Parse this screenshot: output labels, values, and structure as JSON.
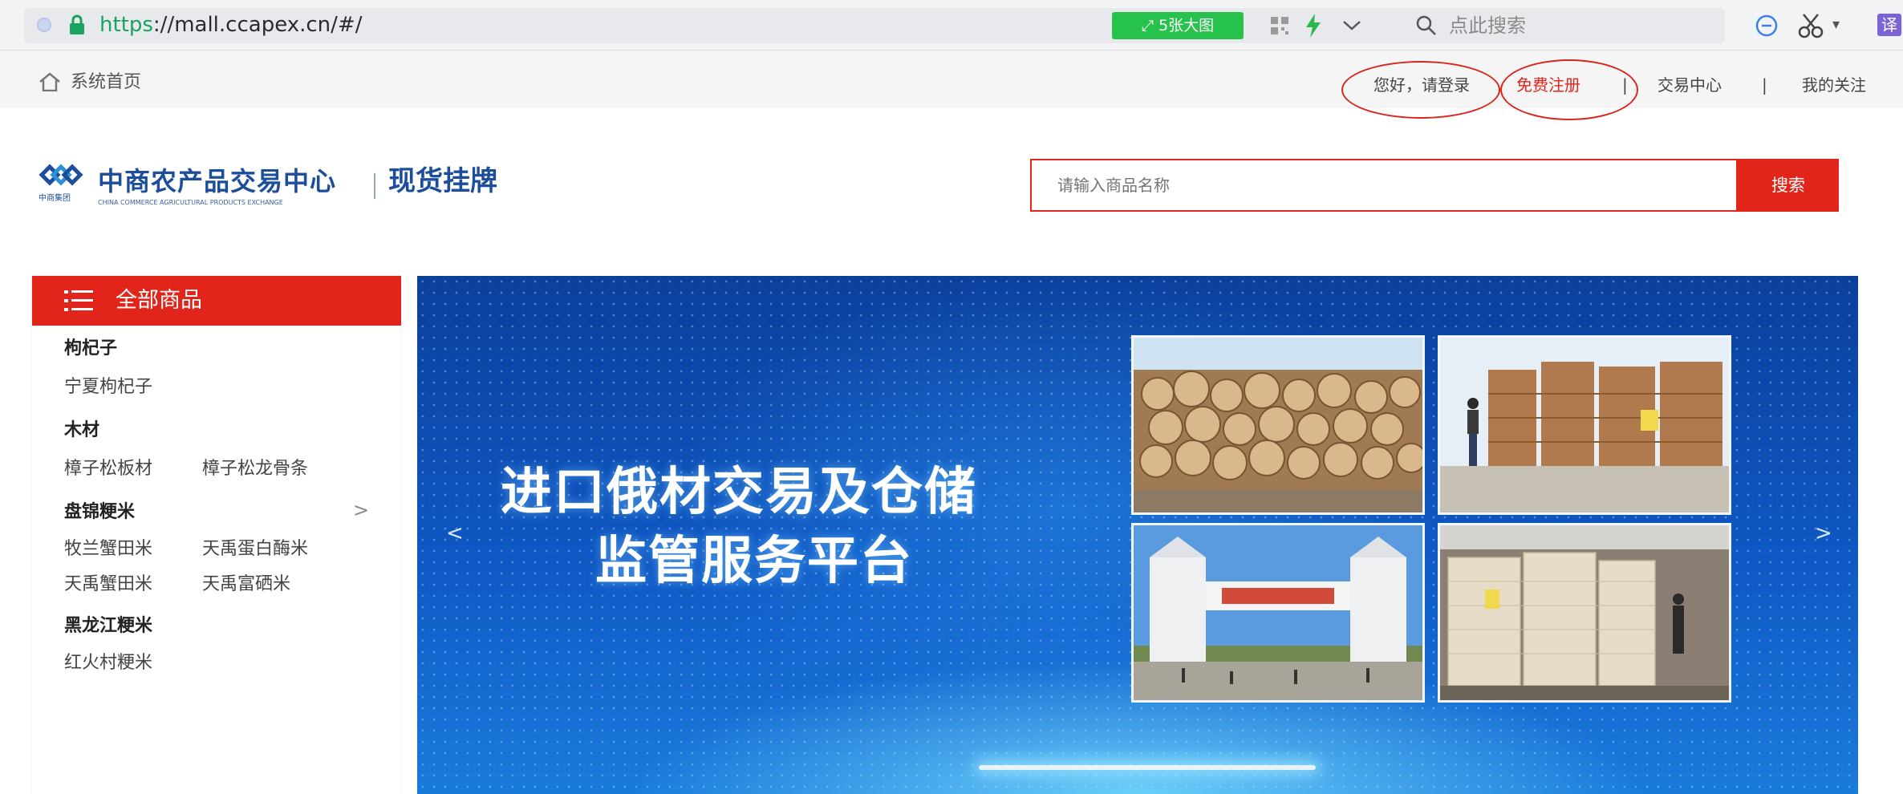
{
  "browser": {
    "url_scheme": "https",
    "url_rest": "://mall.ccapex.cn/#/",
    "big_pic_button": "5张大图",
    "search_placeholder": "点此搜索",
    "translate_label": "译",
    "accent_green": "#27c24c"
  },
  "top_nav": {
    "home_label": "系统首页",
    "login_label": "您好，请登录",
    "register_label": "免费注册",
    "separator": "|",
    "trade_center_label": "交易中心",
    "my_follow_label": "我的关注"
  },
  "header": {
    "logo_cn": "中商农产品交易中心",
    "logo_en": "CHINA COMMERCE AGRICULTURAL PRODUCTS EXCHANGE",
    "logo_mark_text": "中商集团",
    "subtitle": "现货挂牌",
    "search_placeholder": "请输入商品名称",
    "search_button": "搜索",
    "brand_red": "#e1251b",
    "brand_blue": "#1d4e9b"
  },
  "sidebar": {
    "title": "全部商品",
    "arrow": ">",
    "categories": [
      {
        "name": "枸杞子",
        "items": [
          "宁夏枸杞子"
        ]
      },
      {
        "name": "木材",
        "items": [
          "樟子松板材",
          "樟子松龙骨条"
        ]
      },
      {
        "name": "盘锦粳米",
        "items": [
          "牧兰蟹田米",
          "天禹蛋白酶米",
          "天禹蟹田米",
          "天禹富硒米"
        ]
      },
      {
        "name": "黑龙江粳米",
        "items": [
          "红火村粳米"
        ]
      }
    ]
  },
  "banner": {
    "title_line1": "进口俄材交易及仓储",
    "title_line2": "监管服务平台",
    "arrow_left": "<",
    "arrow_right": ">"
  }
}
